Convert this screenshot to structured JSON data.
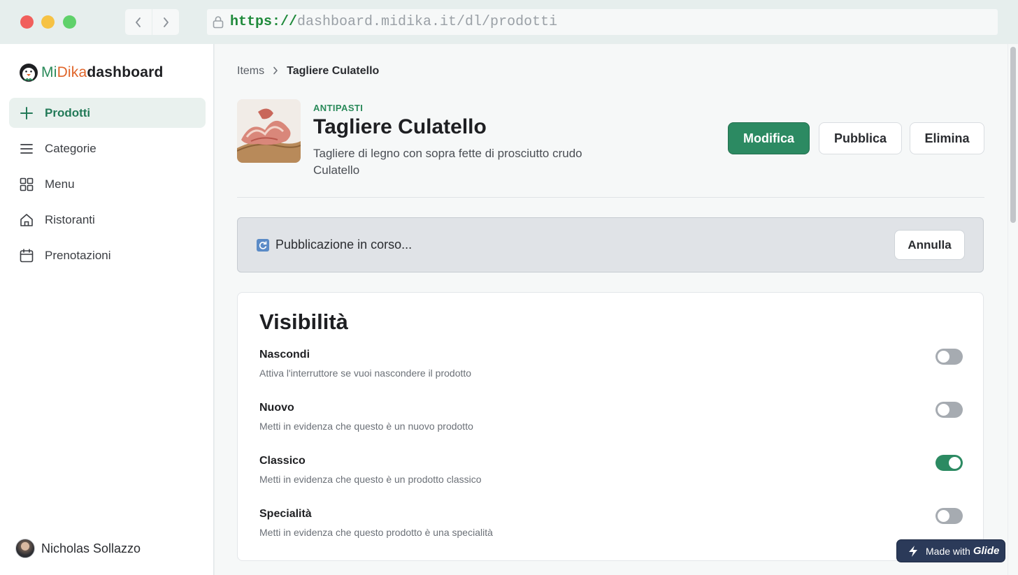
{
  "browser": {
    "url_scheme": "https://",
    "url_rest": "dashboard.midika.it/dl/prodotti"
  },
  "brand": {
    "mi": "Mi",
    "dika": "Dika",
    "dashboard": "dashboard"
  },
  "sidebar": {
    "items": [
      {
        "label": "Prodotti",
        "icon": "plus-icon",
        "active": true
      },
      {
        "label": "Categorie",
        "icon": "menu-lines-icon"
      },
      {
        "label": "Menu",
        "icon": "grid-icon"
      },
      {
        "label": "Ristoranti",
        "icon": "home-icon"
      },
      {
        "label": "Prenotazioni",
        "icon": "calendar-icon"
      }
    ],
    "user_name": "Nicholas Sollazzo"
  },
  "breadcrumb": {
    "parent": "Items",
    "current": "Tagliere Culatello"
  },
  "product": {
    "category": "ANTIPASTI",
    "title": "Tagliere Culatello",
    "description": "Tagliere di legno con sopra fette di prosciutto crudo Culatello"
  },
  "actions": {
    "edit": "Modifica",
    "publish": "Pubblica",
    "delete": "Elimina"
  },
  "banner": {
    "text": "Pubblicazione in corso...",
    "cancel": "Annulla"
  },
  "visibility": {
    "title": "Visibilità",
    "rows": [
      {
        "label": "Nascondi",
        "hint": "Attiva l'interruttore se vuoi nascondere il prodotto",
        "on": false
      },
      {
        "label": "Nuovo",
        "hint": "Metti in evidenza che questo è un nuovo prodotto",
        "on": false
      },
      {
        "label": "Classico",
        "hint": "Metti in evidenza che questo è un prodotto classico",
        "on": true
      },
      {
        "label": "Specialità",
        "hint": "Metti in evidenza che questo prodotto è una specialità",
        "on": false
      }
    ]
  },
  "badge": {
    "prefix": "Made with",
    "brand": "Glide"
  },
  "colors": {
    "accent": "#2c8a62",
    "brand_orange": "#e0652a",
    "toggle_off": "#a6abb1"
  }
}
